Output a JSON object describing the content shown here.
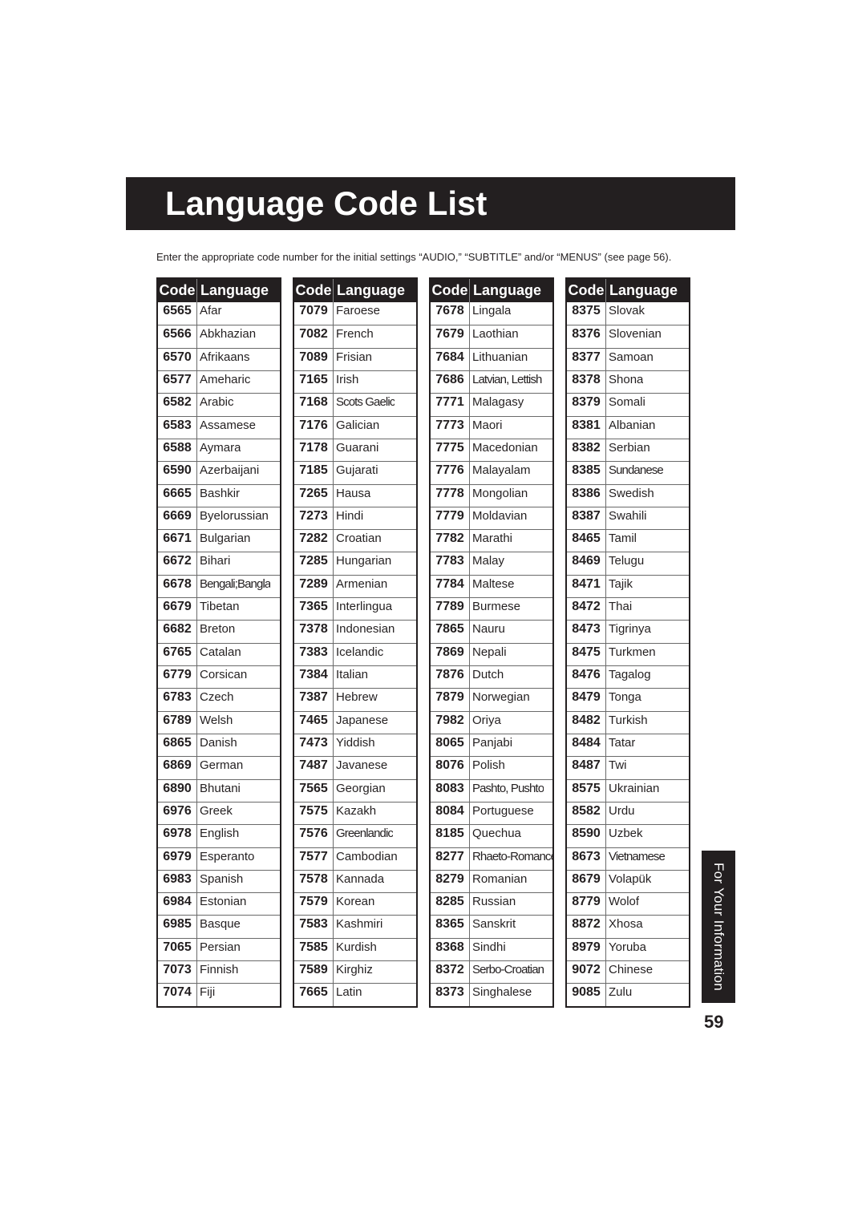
{
  "title": "Language Code List",
  "intro": "Enter the appropriate code number for the initial settings “AUDIO,” “SUBTITLE” and/or “MENUS” (see page 56).",
  "header": {
    "code": "Code",
    "language": "Language"
  },
  "tables": [
    {
      "rows": [
        {
          "code": "6565",
          "language": "Afar"
        },
        {
          "code": "6566",
          "language": "Abkhazian"
        },
        {
          "code": "6570",
          "language": "Afrikaans"
        },
        {
          "code": "6577",
          "language": "Ameharic"
        },
        {
          "code": "6582",
          "language": "Arabic"
        },
        {
          "code": "6583",
          "language": "Assamese"
        },
        {
          "code": "6588",
          "language": "Aymara"
        },
        {
          "code": "6590",
          "language": "Azerbaijani"
        },
        {
          "code": "6665",
          "language": "Bashkir"
        },
        {
          "code": "6669",
          "language": "Byelorussian"
        },
        {
          "code": "6671",
          "language": "Bulgarian"
        },
        {
          "code": "6672",
          "language": "Bihari"
        },
        {
          "code": "6678",
          "language": "Bengali;Bangla"
        },
        {
          "code": "6679",
          "language": "Tibetan"
        },
        {
          "code": "6682",
          "language": "Breton"
        },
        {
          "code": "6765",
          "language": "Catalan"
        },
        {
          "code": "6779",
          "language": "Corsican"
        },
        {
          "code": "6783",
          "language": "Czech"
        },
        {
          "code": "6789",
          "language": "Welsh"
        },
        {
          "code": "6865",
          "language": "Danish"
        },
        {
          "code": "6869",
          "language": "German"
        },
        {
          "code": "6890",
          "language": "Bhutani"
        },
        {
          "code": "6976",
          "language": "Greek"
        },
        {
          "code": "6978",
          "language": "English"
        },
        {
          "code": "6979",
          "language": "Esperanto"
        },
        {
          "code": "6983",
          "language": "Spanish"
        },
        {
          "code": "6984",
          "language": "Estonian"
        },
        {
          "code": "6985",
          "language": "Basque"
        },
        {
          "code": "7065",
          "language": "Persian"
        },
        {
          "code": "7073",
          "language": "Finnish"
        },
        {
          "code": "7074",
          "language": "Fiji"
        }
      ]
    },
    {
      "rows": [
        {
          "code": "7079",
          "language": "Faroese"
        },
        {
          "code": "7082",
          "language": "French"
        },
        {
          "code": "7089",
          "language": "Frisian"
        },
        {
          "code": "7165",
          "language": "Irish"
        },
        {
          "code": "7168",
          "language": "Scots Gaelic"
        },
        {
          "code": "7176",
          "language": "Galician"
        },
        {
          "code": "7178",
          "language": "Guarani"
        },
        {
          "code": "7185",
          "language": "Gujarati"
        },
        {
          "code": "7265",
          "language": "Hausa"
        },
        {
          "code": "7273",
          "language": "Hindi"
        },
        {
          "code": "7282",
          "language": "Croatian"
        },
        {
          "code": "7285",
          "language": "Hungarian"
        },
        {
          "code": "7289",
          "language": "Armenian"
        },
        {
          "code": "7365",
          "language": "Interlingua"
        },
        {
          "code": "7378",
          "language": "Indonesian"
        },
        {
          "code": "7383",
          "language": "Icelandic"
        },
        {
          "code": "7384",
          "language": "Italian"
        },
        {
          "code": "7387",
          "language": "Hebrew"
        },
        {
          "code": "7465",
          "language": "Japanese"
        },
        {
          "code": "7473",
          "language": "Yiddish"
        },
        {
          "code": "7487",
          "language": "Javanese"
        },
        {
          "code": "7565",
          "language": "Georgian"
        },
        {
          "code": "7575",
          "language": "Kazakh"
        },
        {
          "code": "7576",
          "language": "Greenlandic"
        },
        {
          "code": "7577",
          "language": "Cambodian"
        },
        {
          "code": "7578",
          "language": "Kannada"
        },
        {
          "code": "7579",
          "language": "Korean"
        },
        {
          "code": "7583",
          "language": "Kashmiri"
        },
        {
          "code": "7585",
          "language": "Kurdish"
        },
        {
          "code": "7589",
          "language": "Kirghiz"
        },
        {
          "code": "7665",
          "language": "Latin"
        }
      ]
    },
    {
      "rows": [
        {
          "code": "7678",
          "language": "Lingala"
        },
        {
          "code": "7679",
          "language": "Laothian"
        },
        {
          "code": "7684",
          "language": "Lithuanian"
        },
        {
          "code": "7686",
          "language": "Latvian, Lettish"
        },
        {
          "code": "7771",
          "language": "Malagasy"
        },
        {
          "code": "7773",
          "language": "Maori"
        },
        {
          "code": "7775",
          "language": "Macedonian"
        },
        {
          "code": "7776",
          "language": "Malayalam"
        },
        {
          "code": "7778",
          "language": "Mongolian"
        },
        {
          "code": "7779",
          "language": "Moldavian"
        },
        {
          "code": "7782",
          "language": "Marathi"
        },
        {
          "code": "7783",
          "language": "Malay"
        },
        {
          "code": "7784",
          "language": "Maltese"
        },
        {
          "code": "7789",
          "language": "Burmese"
        },
        {
          "code": "7865",
          "language": "Nauru"
        },
        {
          "code": "7869",
          "language": "Nepali"
        },
        {
          "code": "7876",
          "language": "Dutch"
        },
        {
          "code": "7879",
          "language": "Norwegian"
        },
        {
          "code": "7982",
          "language": "Oriya"
        },
        {
          "code": "8065",
          "language": "Panjabi"
        },
        {
          "code": "8076",
          "language": "Polish"
        },
        {
          "code": "8083",
          "language": "Pashto, Pushto"
        },
        {
          "code": "8084",
          "language": "Portuguese"
        },
        {
          "code": "8185",
          "language": "Quechua"
        },
        {
          "code": "8277",
          "language": "Rhaeto-Romance"
        },
        {
          "code": "8279",
          "language": "Romanian"
        },
        {
          "code": "8285",
          "language": "Russian"
        },
        {
          "code": "8365",
          "language": "Sanskrit"
        },
        {
          "code": "8368",
          "language": "Sindhi"
        },
        {
          "code": "8372",
          "language": "Serbo-Croatian"
        },
        {
          "code": "8373",
          "language": "Singhalese"
        }
      ]
    },
    {
      "rows": [
        {
          "code": "8375",
          "language": "Slovak"
        },
        {
          "code": "8376",
          "language": "Slovenian"
        },
        {
          "code": "8377",
          "language": "Samoan"
        },
        {
          "code": "8378",
          "language": "Shona"
        },
        {
          "code": "8379",
          "language": "Somali"
        },
        {
          "code": "8381",
          "language": "Albanian"
        },
        {
          "code": "8382",
          "language": "Serbian"
        },
        {
          "code": "8385",
          "language": "Sundanese"
        },
        {
          "code": "8386",
          "language": "Swedish"
        },
        {
          "code": "8387",
          "language": "Swahili"
        },
        {
          "code": "8465",
          "language": "Tamil"
        },
        {
          "code": "8469",
          "language": "Telugu"
        },
        {
          "code": "8471",
          "language": "Tajik"
        },
        {
          "code": "8472",
          "language": "Thai"
        },
        {
          "code": "8473",
          "language": "Tigrinya"
        },
        {
          "code": "8475",
          "language": "Turkmen"
        },
        {
          "code": "8476",
          "language": "Tagalog"
        },
        {
          "code": "8479",
          "language": "Tonga"
        },
        {
          "code": "8482",
          "language": "Turkish"
        },
        {
          "code": "8484",
          "language": "Tatar"
        },
        {
          "code": "8487",
          "language": "Twi"
        },
        {
          "code": "8575",
          "language": "Ukrainian"
        },
        {
          "code": "8582",
          "language": "Urdu"
        },
        {
          "code": "8590",
          "language": "Uzbek"
        },
        {
          "code": "8673",
          "language": "Vietnamese"
        },
        {
          "code": "8679",
          "language": "Volapük"
        },
        {
          "code": "8779",
          "language": "Wolof"
        },
        {
          "code": "8872",
          "language": "Xhosa"
        },
        {
          "code": "8979",
          "language": "Yoruba"
        },
        {
          "code": "9072",
          "language": "Chinese"
        },
        {
          "code": "9085",
          "language": "Zulu"
        }
      ]
    }
  ],
  "side_tab": "For Your Information",
  "page_number": "59"
}
